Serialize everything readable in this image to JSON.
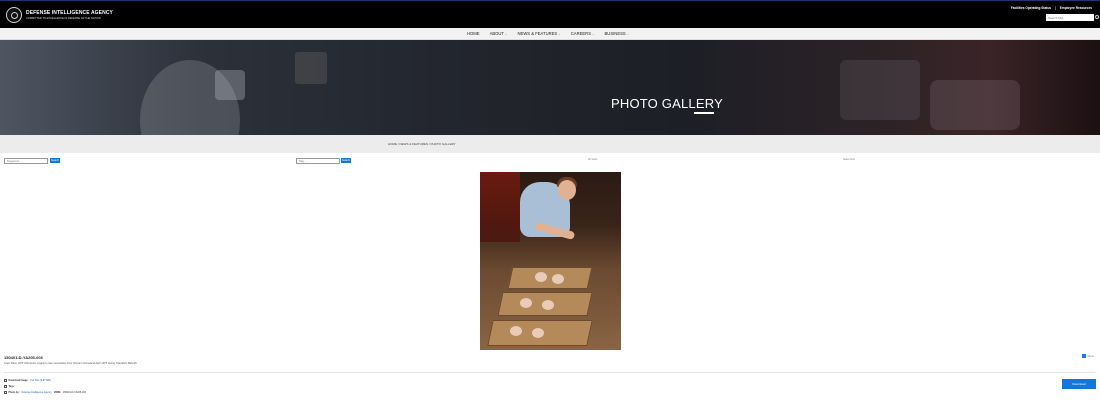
{
  "header": {
    "agency_name": "DEFENSE INTELLIGENCE AGENCY",
    "agency_tagline": "COMMITTED TO EXCELLENCE IN DEFENSE OF THE NATION",
    "util_links": [
      "Facilities Operating Status",
      "Employee Resources"
    ],
    "util_separator": "|",
    "search_placeholder": "Search DIA"
  },
  "nav": {
    "items": [
      {
        "label": "HOME",
        "has_dropdown": false
      },
      {
        "label": "ABOUT",
        "has_dropdown": true
      },
      {
        "label": "NEWS & FEATURES",
        "has_dropdown": true
      },
      {
        "label": "CAREERS",
        "has_dropdown": true
      },
      {
        "label": "BUSINESS",
        "has_dropdown": true
      }
    ]
  },
  "hero": {
    "title": "PHOTO GALLERY"
  },
  "breadcrumb": "HOME / NEWS & FEATURES / PHOTO GALLERY",
  "filters": {
    "keyword_placeholder": "Keyword ...",
    "keyword_button": "Search",
    "tag_placeholder": "Tag ...",
    "tag_button": "Search",
    "select_a_label": "All Years",
    "select_b_label": "Select Item"
  },
  "photo": {
    "id": "150401-D-YA205-003",
    "caption": "Crew Race 1975 Volunteers organize care necessities from Vietnam Homeland April 1975 during Operation Babylift.",
    "share_label": "Share"
  },
  "metadata": {
    "download_label": "Download Image:",
    "download_value": "Full Size (6.87 MB)",
    "tags_label": "Tags:",
    "tags_value": "",
    "photo_by_label": "Photo by:",
    "photo_by_value": "Defense Intelligence Agency",
    "vida_label": "VIRIN:",
    "vida_value": "150401-D-YA205-003"
  },
  "download_button": "Download",
  "colors": {
    "accent": "#1277d9",
    "topbar": "#000000",
    "nav_bg": "#f2f2f2",
    "crumb_bg": "#ececec"
  }
}
